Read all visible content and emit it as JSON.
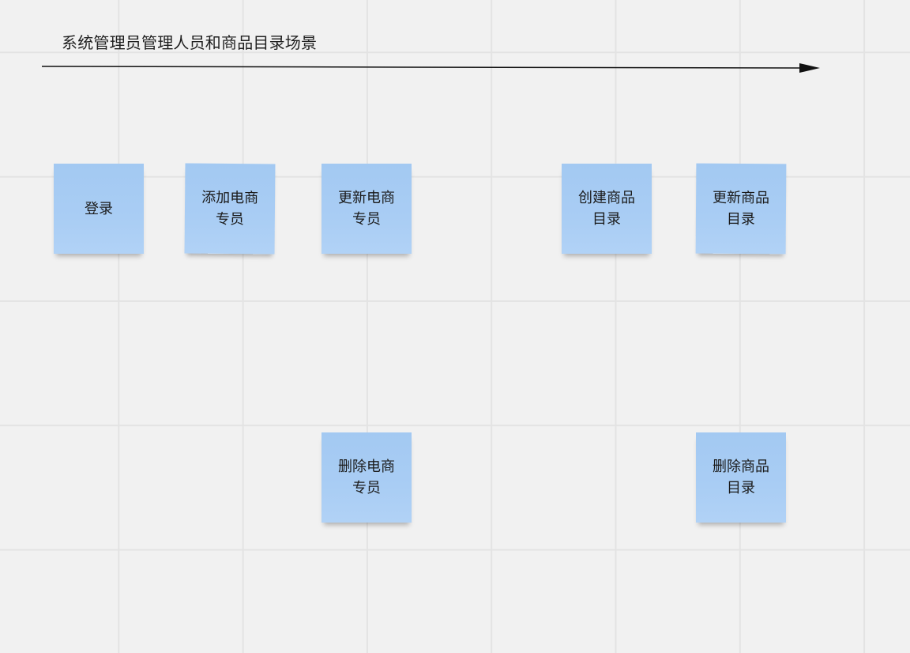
{
  "title": "系统管理员管理人员和商品目录场景",
  "notes": [
    {
      "text": "登录"
    },
    {
      "text": "添加电商专员"
    },
    {
      "text": "更新电商专员"
    },
    {
      "text": "创建商品目录"
    },
    {
      "text": "更新商品目录"
    },
    {
      "text": "删除电商专员"
    },
    {
      "text": "删除商品目录"
    }
  ],
  "colors": {
    "background": "#f1f1f1",
    "grid": "#e3e3e3",
    "sticky_note": "#a9cdf4",
    "text": "#1b1b1b",
    "arrow": "#111111"
  }
}
